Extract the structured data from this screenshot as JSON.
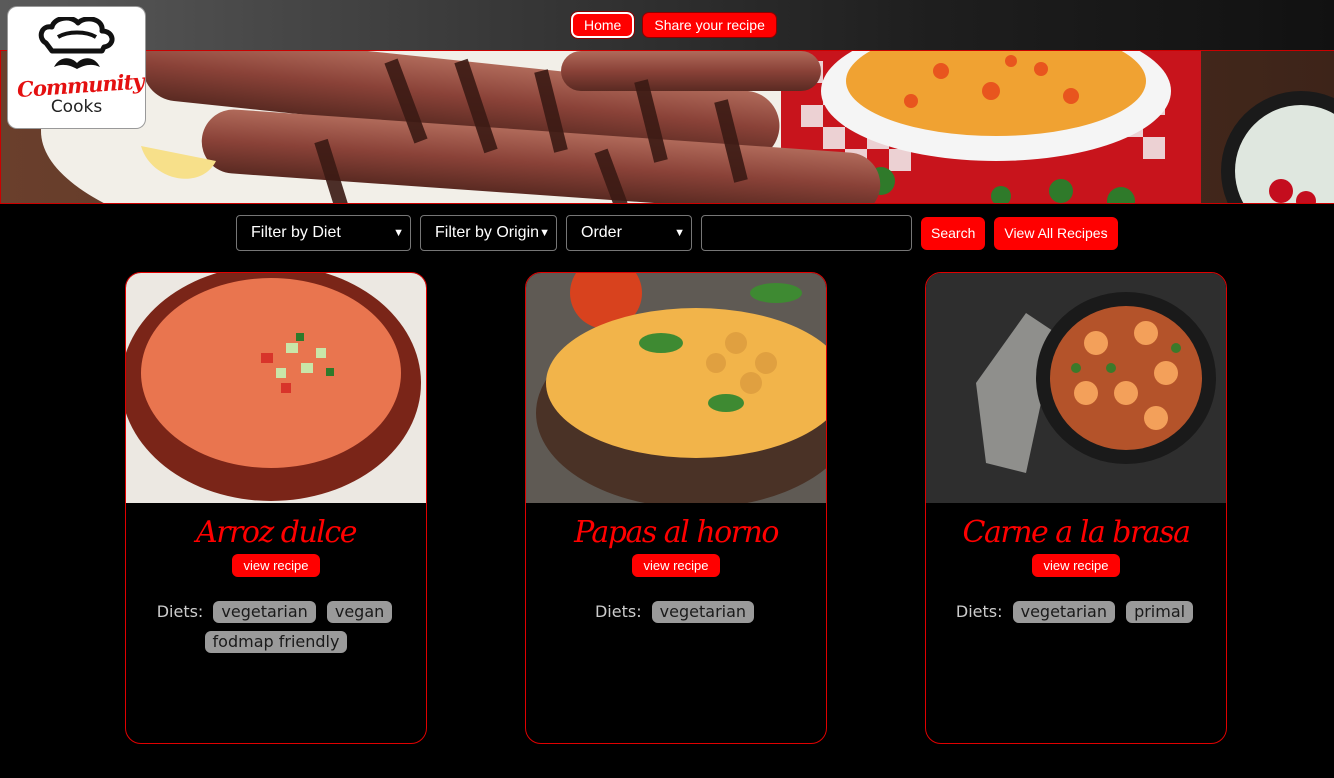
{
  "nav": {
    "home": "Home",
    "share": "Share your recipe"
  },
  "logo": {
    "script": "Community",
    "sub": "Cooks"
  },
  "filters": {
    "diet": "Filter by Diet",
    "origin": "Filter by Origin",
    "order": "Order",
    "search_value": "",
    "search_button": "Search",
    "view_all": "View All Recipes"
  },
  "cards": [
    {
      "title": "Arroz dulce",
      "button": "view recipe",
      "diets_label": "Diets:",
      "diets": [
        "vegetarian",
        "vegan",
        "fodmap friendly"
      ]
    },
    {
      "title": "Papas al horno",
      "button": "view recipe",
      "diets_label": "Diets:",
      "diets": [
        "vegetarian"
      ]
    },
    {
      "title": "Carne a la brasa",
      "button": "view recipe",
      "diets_label": "Diets:",
      "diets": [
        "vegetarian",
        "primal"
      ]
    }
  ],
  "colors": {
    "accent": "#ff0000",
    "background": "#000000",
    "tag": "#9a9a9a"
  }
}
